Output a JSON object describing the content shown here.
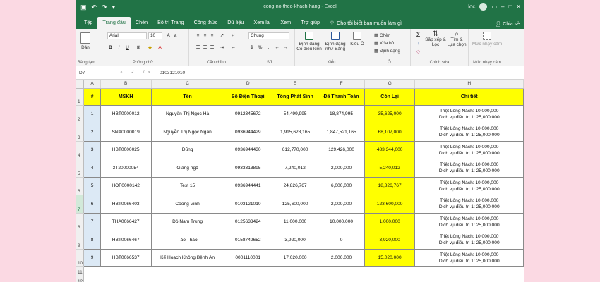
{
  "titlebar": {
    "title": "cong-no-theo-khach-hang  -  Excel",
    "user": "loc"
  },
  "tabs": [
    "Tệp",
    "Trang đầu",
    "Chèn",
    "Bố trí Trang",
    "Công thức",
    "Dữ liệu",
    "Xem lại",
    "Xem",
    "Trợ giúp"
  ],
  "active_tab": "Trang đầu",
  "tell_me": "Cho tôi biết bạn muốn làm gì",
  "share": "Chia sẻ",
  "ribbon": {
    "paste": "Dán",
    "clipboard_label": "Bảng tạm",
    "font_name": "Arial",
    "font_size": "10",
    "font_label": "Phông chữ",
    "align_label": "Căn chỉnh",
    "number_format": "Chung",
    "number_label": "Số",
    "cond_format": "Định dạng Có điều kiện",
    "format_table": "Định dạng như Bảng",
    "cell_styles": "Kiểu Ô",
    "styles_label": "Kiểu",
    "insert": "Chèn",
    "delete": "Xóa bỏ",
    "format": "Định dạng",
    "cells_label": "Ô",
    "sort_filter": "Sắp xếp & Lọc",
    "find_select": "Tìm & Lựa chọn",
    "editing_label": "Chỉnh sửa",
    "sensitivity": "Mức nhạy cảm",
    "sensitivity_label": "Mức nhạy cảm"
  },
  "formula_bar": {
    "name_box": "D7",
    "fx": "×  ✓  fx",
    "value": "0103121010"
  },
  "sheet": {
    "columns": [
      "A",
      "B",
      "C",
      "D",
      "E",
      "F",
      "G",
      "H"
    ],
    "headers": [
      "#",
      "MSKH",
      "Tên",
      "Số Điện Thoại",
      "Tổng Phát Sinh",
      "Đã Thanh Toán",
      "Còn Lại",
      "Chi tiết"
    ],
    "rows": [
      {
        "num": "1",
        "mskh": "HBT0000012",
        "ten": "Nguyễn Thị Ngọc Hà",
        "sdt": "0912345672",
        "tps": "54,499,995",
        "dtt": "18,874,995",
        "cl": "35,625,000",
        "ct1": "Triệt Lông Nách: 10,000,000",
        "ct2": "Dịch vụ điều trị 1: 25,000,000"
      },
      {
        "num": "2",
        "mskh": "SNA0000019",
        "ten": "Nguyễn Thị Ngọc Ngân",
        "sdt": "0936944429",
        "tps": "1,915,628,165",
        "dtt": "1,847,521,165",
        "cl": "68,107,000",
        "ct1": "Triệt Lông Nách: 10,000,000",
        "ct2": "Dịch vụ điều trị 1: 25,000,000"
      },
      {
        "num": "3",
        "mskh": "HBT0000025",
        "ten": "Dũng",
        "sdt": "0936944430",
        "tps": "612,770,000",
        "dtt": "129,426,000",
        "cl": "483,344,000",
        "ct1": "Triệt Lông Nách: 10,000,000",
        "ct2": "Dịch vụ điều trị 1: 25,000,000"
      },
      {
        "num": "4",
        "mskh": "3T20000054",
        "ten": "Giang ngô",
        "sdt": "0933313895",
        "tps": "7,240,012",
        "dtt": "2,000,000",
        "cl": "5,240,012",
        "ct1": "Triệt Lông Nách: 10,000,000",
        "ct2": "Dịch vụ điều trị 1: 25,000,000"
      },
      {
        "num": "5",
        "mskh": "HOF0000142",
        "ten": "Test 15",
        "sdt": "0936944441",
        "tps": "24,826,767",
        "dtt": "6,000,000",
        "cl": "18,826,767",
        "ct1": "Triệt Lông Nách: 10,000,000",
        "ct2": "Dịch vụ điều trị 1: 25,000,000"
      },
      {
        "num": "6",
        "mskh": "HBT0066403",
        "ten": "Coong Vinh",
        "sdt": "0103121010",
        "tps": "125,600,000",
        "dtt": "2,000,000",
        "cl": "123,600,000",
        "ct1": "Triệt Lông Nách: 10,000,000",
        "ct2": "Dịch vụ điều trị 1: 25,000,000"
      },
      {
        "num": "7",
        "mskh": "THA0066427",
        "ten": "Đỗ Nam Trung",
        "sdt": "0125633424",
        "tps": "11,000,000",
        "dtt": "10,000,000",
        "cl": "1,000,000",
        "ct1": "Triệt Lông Nách: 10,000,000",
        "ct2": "Dịch vụ điều trị 1: 25,000,000"
      },
      {
        "num": "8",
        "mskh": "HBT0066467",
        "ten": "Tào Tháo",
        "sdt": "0158749652",
        "tps": "3,920,000",
        "dtt": "0",
        "cl": "3,920,000",
        "ct1": "Triệt Lông Nách: 10,000,000",
        "ct2": "Dịch vụ điều trị 1: 25,000,000"
      },
      {
        "num": "9",
        "mskh": "HBT0066537",
        "ten": "Kế Hoạch Không Bệnh Án",
        "sdt": "0001110001",
        "tps": "17,020,000",
        "dtt": "2,000,000",
        "cl": "15,020,000",
        "ct1": "Triệt Lông Nách: 10,000,000",
        "ct2": "Dịch vụ điều trị 1: 25,000,000"
      }
    ]
  },
  "colors": {
    "excel_green": "#217346",
    "header_yellow": "#ffff00",
    "index_blue": "#dce9f5",
    "background_pink": "#fbd9e3"
  }
}
